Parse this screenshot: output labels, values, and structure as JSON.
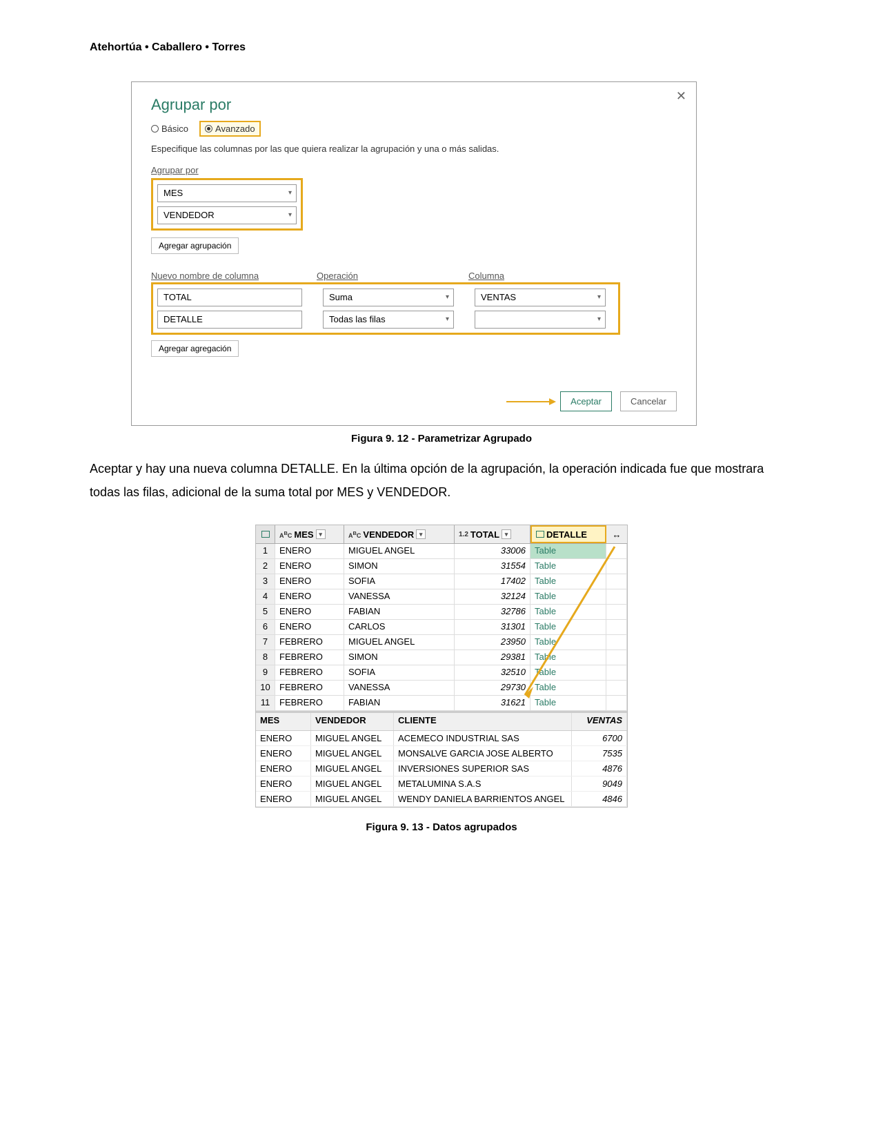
{
  "authors": "Atehortúa • Caballero • Torres",
  "dialog1": {
    "title": "Agrupar por",
    "radio_basic": "Básico",
    "radio_advanced": "Avanzado",
    "description": "Especifique las columnas por las que quiera realizar la agrupación y una o más salidas.",
    "group_by_label": "Agrupar por",
    "group_field1": "MES",
    "group_field2": "VENDEDOR",
    "add_group_btn": "Agregar agrupación",
    "col1_header": "Nuevo nombre de columna",
    "col2_header": "Operación",
    "col3_header": "Columna",
    "agg": [
      {
        "name": "TOTAL",
        "op": "Suma",
        "col": "VENTAS"
      },
      {
        "name": "DETALLE",
        "op": "Todas las filas",
        "col": ""
      }
    ],
    "add_agg_btn": "Agregar agregación",
    "accept": "Aceptar",
    "cancel": "Cancelar"
  },
  "caption1": "Figura 9. 12 - Parametrizar Agrupado",
  "body_paragraph": "Aceptar y hay una nueva columna DETALLE. En la última opción de la agrupación, la operación indicada fue que mostrara todas las filas, adicional de la suma total por MES y VENDEDOR.",
  "table2": {
    "headers": {
      "mes": "MES",
      "vendedor": "VENDEDOR",
      "total": "TOTAL",
      "detalle": "DETALLE",
      "type_prefix": "1.2",
      "abc": "ABC"
    },
    "rows": [
      {
        "n": "1",
        "mes": "ENERO",
        "ven": "MIGUEL ANGEL",
        "tot": "33006",
        "det": "Table"
      },
      {
        "n": "2",
        "mes": "ENERO",
        "ven": "SIMON",
        "tot": "31554",
        "det": "Table"
      },
      {
        "n": "3",
        "mes": "ENERO",
        "ven": "SOFIA",
        "tot": "17402",
        "det": "Table"
      },
      {
        "n": "4",
        "mes": "ENERO",
        "ven": "VANESSA",
        "tot": "32124",
        "det": "Table"
      },
      {
        "n": "5",
        "mes": "ENERO",
        "ven": "FABIAN",
        "tot": "32786",
        "det": "Table"
      },
      {
        "n": "6",
        "mes": "ENERO",
        "ven": "CARLOS",
        "tot": "31301",
        "det": "Table"
      },
      {
        "n": "7",
        "mes": "FEBRERO",
        "ven": "MIGUEL ANGEL",
        "tot": "23950",
        "det": "Table"
      },
      {
        "n": "8",
        "mes": "FEBRERO",
        "ven": "SIMON",
        "tot": "29381",
        "det": "Table"
      },
      {
        "n": "9",
        "mes": "FEBRERO",
        "ven": "SOFIA",
        "tot": "32510",
        "det": "Table"
      },
      {
        "n": "10",
        "mes": "FEBRERO",
        "ven": "VANESSA",
        "tot": "29730",
        "det": "Table"
      },
      {
        "n": "11",
        "mes": "FEBRERO",
        "ven": "FABIAN",
        "tot": "31621",
        "det": "Table"
      }
    ],
    "detail_headers": {
      "mes": "MES",
      "ven": "VENDEDOR",
      "cli": "CLIENTE",
      "vta": "VENTAS"
    },
    "detail_rows": [
      {
        "mes": "ENERO",
        "ven": "MIGUEL ANGEL",
        "cli": "ACEMECO INDUSTRIAL SAS",
        "vta": "6700"
      },
      {
        "mes": "ENERO",
        "ven": "MIGUEL ANGEL",
        "cli": "MONSALVE GARCIA JOSE ALBERTO",
        "vta": "7535"
      },
      {
        "mes": "ENERO",
        "ven": "MIGUEL ANGEL",
        "cli": "INVERSIONES SUPERIOR SAS",
        "vta": "4876"
      },
      {
        "mes": "ENERO",
        "ven": "MIGUEL ANGEL",
        "cli": "METALUMINA S.A.S",
        "vta": "9049"
      },
      {
        "mes": "ENERO",
        "ven": "MIGUEL ANGEL",
        "cli": "WENDY DANIELA BARRIENTOS ANGEL",
        "vta": "4846"
      }
    ]
  },
  "caption2": "Figura 9. 13 - Datos agrupados"
}
